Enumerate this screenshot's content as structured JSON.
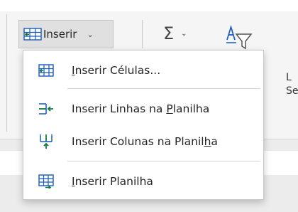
{
  "ribbon": {
    "insert_button_label": "Inserir",
    "sum_symbol": "Σ",
    "clipped_text_1": "L",
    "clipped_text_2": "Se"
  },
  "menu": {
    "items": [
      {
        "pre": "",
        "key": "I",
        "post": "nserir Células...",
        "icon": "insert-cells-icon"
      },
      {
        "pre": "Inserir Linhas na ",
        "key": "P",
        "post": "lanilha",
        "icon": "insert-sheet-rows-icon"
      },
      {
        "pre": "Inserir Colunas na Planil",
        "key": "h",
        "post": "a",
        "icon": "insert-sheet-columns-icon"
      },
      {
        "pre": "",
        "key": "I",
        "post": "nserir Planilha",
        "icon": "insert-sheet-icon"
      }
    ]
  },
  "colors": {
    "accent_blue": "#185abd",
    "accent_green": "#107c41",
    "menu_bg": "#ffffff",
    "pressed_bg": "#e0e0e0"
  }
}
